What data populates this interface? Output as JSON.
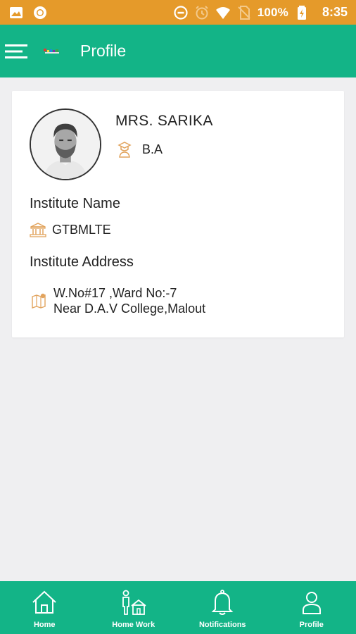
{
  "status_bar": {
    "battery_percent": "100%",
    "time": "8:35",
    "icons": [
      "image-icon",
      "record-icon",
      "do-not-disturb-icon",
      "alarm-icon",
      "wifi-icon",
      "no-sim-icon",
      "battery-charging-icon"
    ]
  },
  "app_bar": {
    "title": "Profile",
    "menu_icon": "hamburger-menu-icon",
    "logo": "app-logo"
  },
  "profile": {
    "name": "MRS. SARIKA",
    "qualification": "B.A",
    "institute_name_label": "Institute Name",
    "institute_name": "GTBMLTE",
    "institute_address_label": "Institute Address",
    "address_line1": "W.No#17 ,Ward No:-7",
    "address_line2": "Near  D.A.V College,Malout"
  },
  "bottom_nav": {
    "items": [
      {
        "label": "Home",
        "icon": "home-icon"
      },
      {
        "label": "Home Work",
        "icon": "homework-icon"
      },
      {
        "label": "Notifications",
        "icon": "bell-icon"
      },
      {
        "label": "Profile",
        "icon": "user-icon"
      }
    ]
  },
  "colors": {
    "status_bar": "#e59a2a",
    "primary": "#13b487",
    "background": "#efeff1",
    "icon_accent": "#e2a45e"
  }
}
